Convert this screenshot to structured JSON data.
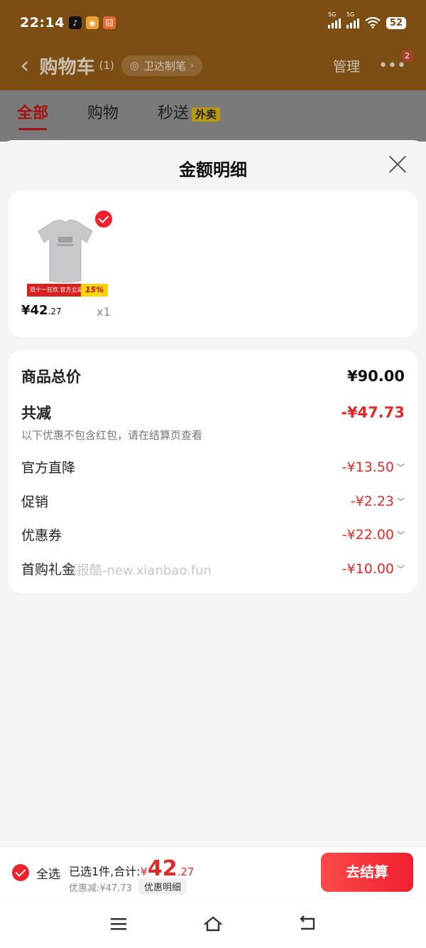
{
  "status": {
    "time": "22:14",
    "battery": "52",
    "net1": "5G",
    "net2": "5G"
  },
  "header": {
    "title": "购物车",
    "count": "(1)",
    "address": "卫达制笔",
    "manage": "管理",
    "more_badge": "2"
  },
  "tabs": [
    {
      "label": "全部"
    },
    {
      "label": "购物"
    },
    {
      "label": "秒送"
    }
  ],
  "tab_badge": "外卖",
  "sheet": {
    "title": "金额明细",
    "product": {
      "price_main": "¥42",
      "price_cents": ".27",
      "qty": "x1",
      "promo_pct": "15%",
      "promo_text": "双十一狂欢 官方立减"
    },
    "total_label": "商品总价",
    "total_value": "¥90.00",
    "reduce_label": "共减",
    "reduce_value": "-¥47.73",
    "reduce_note": "以下优惠不包含红包，请在结算页查看",
    "items": [
      {
        "label": "官方直降",
        "value": "-¥13.50"
      },
      {
        "label": "促销",
        "value": "-¥2.23"
      },
      {
        "label": "优惠券",
        "value": "-¥22.00"
      },
      {
        "label": "首购礼金",
        "value": "-¥10.00"
      }
    ],
    "watermark": "线报酷-new.xianbao.fun"
  },
  "bottom": {
    "select_all": "全选",
    "selected_text": "已选1件,合计:",
    "currency": "¥",
    "total_main": "42",
    "total_cents": ".27",
    "discount": "优惠减:¥47.73",
    "detail_button": "优惠明细",
    "checkout": "去结算"
  },
  "colors": {
    "accent": "#f0212f",
    "header_bg": "#7d4e14"
  }
}
